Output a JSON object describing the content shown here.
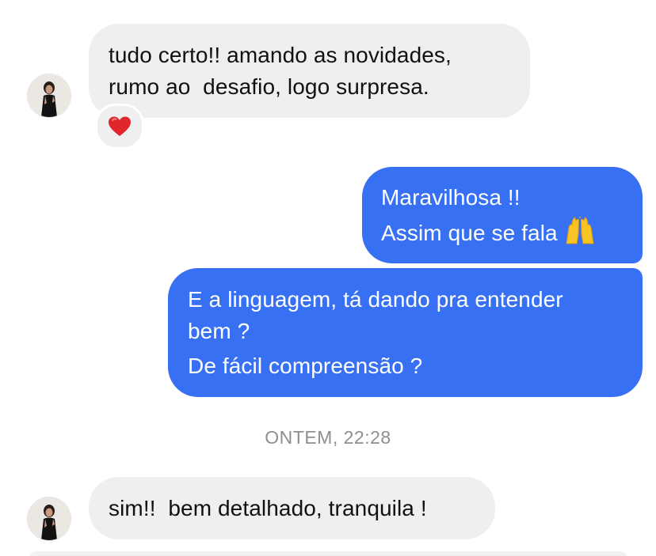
{
  "conversation": {
    "messages": [
      {
        "direction": "incoming",
        "lines": [
          "tudo certo!! amando as novidades,",
          "rumo ao  desafio, logo surpresa."
        ],
        "reaction": "red-heart"
      },
      {
        "direction": "outgoing",
        "lines": [
          "Maravilhosa !!",
          "Assim que se fala"
        ],
        "trailing_emoji": "raising-hands"
      },
      {
        "direction": "outgoing",
        "lines": [
          "E a linguagem, tá dando pra entender",
          "bem ?",
          "De fácil compreensão ?"
        ]
      },
      {
        "direction": "incoming",
        "lines": [
          "sim!!  bem detalhado, tranquila !"
        ]
      }
    ],
    "timestamp": "ONTEM, 22:28"
  },
  "colors": {
    "incoming_bubble": "#efefef",
    "outgoing_bubble": "#3770f3",
    "timestamp_text": "#8e8e8e",
    "reaction_heart": "#e0252b"
  }
}
